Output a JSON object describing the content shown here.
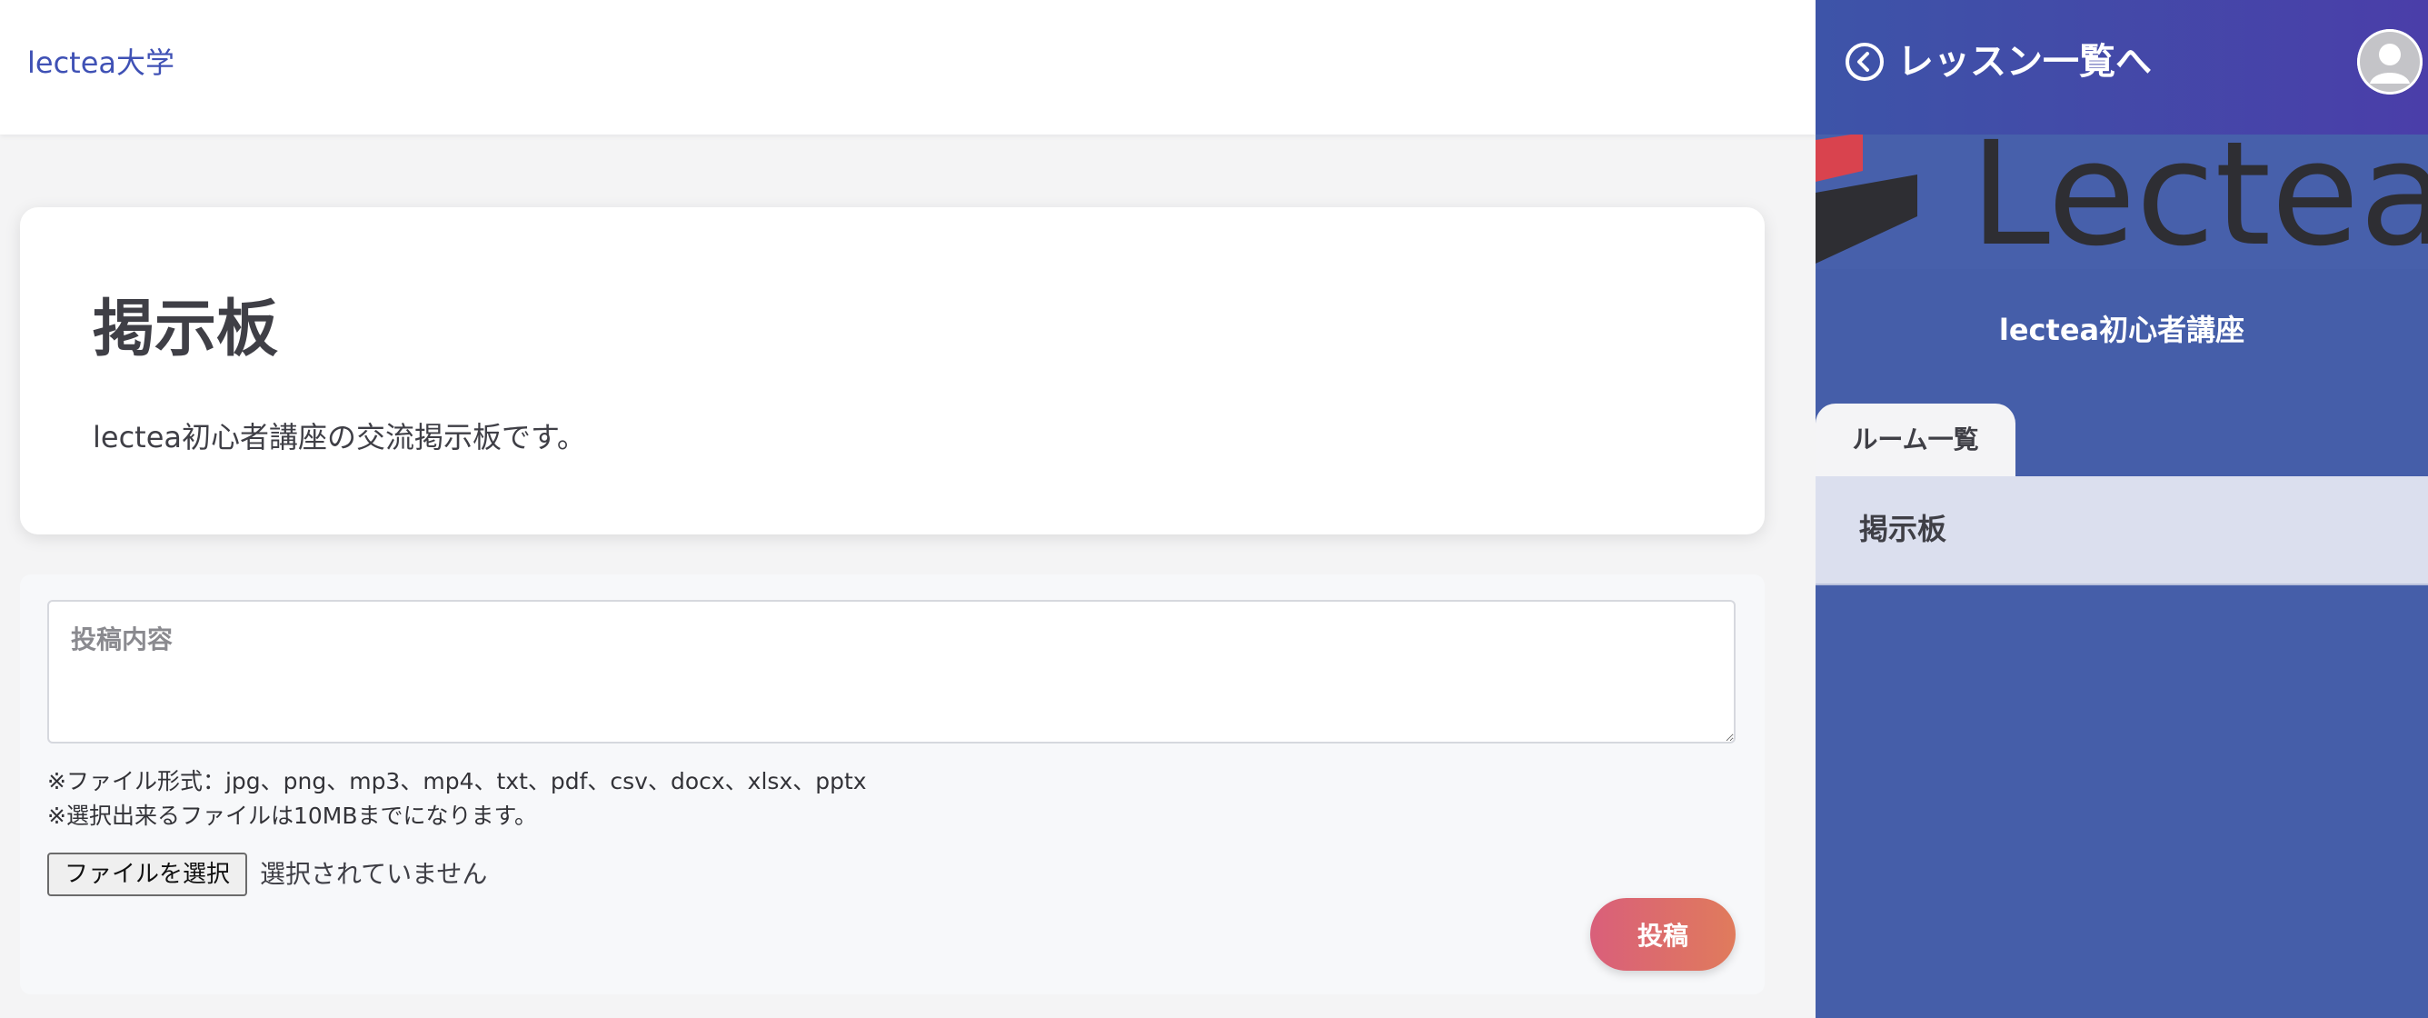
{
  "header": {
    "brand": "lectea大学"
  },
  "board": {
    "title": "掲示板",
    "description": "lectea初心者講座の交流掲示板です。"
  },
  "post_form": {
    "textarea_placeholder": "投稿内容",
    "file_format_note": "※ファイル形式：jpg、png、mp3、mp4、txt、pdf、csv、docx、xlsx、pptx",
    "file_size_note": "※選択出来るファイルは10MBまでになります。",
    "file_button_label": "ファイルを選択",
    "file_status": "選択されていません",
    "submit_label": "投稿"
  },
  "sidebar": {
    "back_label": "レッスン一覧へ",
    "banner_text": "Lectea",
    "course_title": "lectea初心者講座",
    "room_tab_label": "ルーム一覧",
    "rooms": [
      {
        "label": "掲示板"
      }
    ]
  },
  "colors": {
    "brand_text": "#3f51b5",
    "sidebar_bg": "#455ea9",
    "submit_gradient_start": "#d95f7a",
    "submit_gradient_end": "#e07b5c",
    "room_active_bg": "#dbdfee"
  },
  "icons": {
    "back": "chevron-left-circle-icon",
    "avatar": "user-avatar-icon"
  }
}
